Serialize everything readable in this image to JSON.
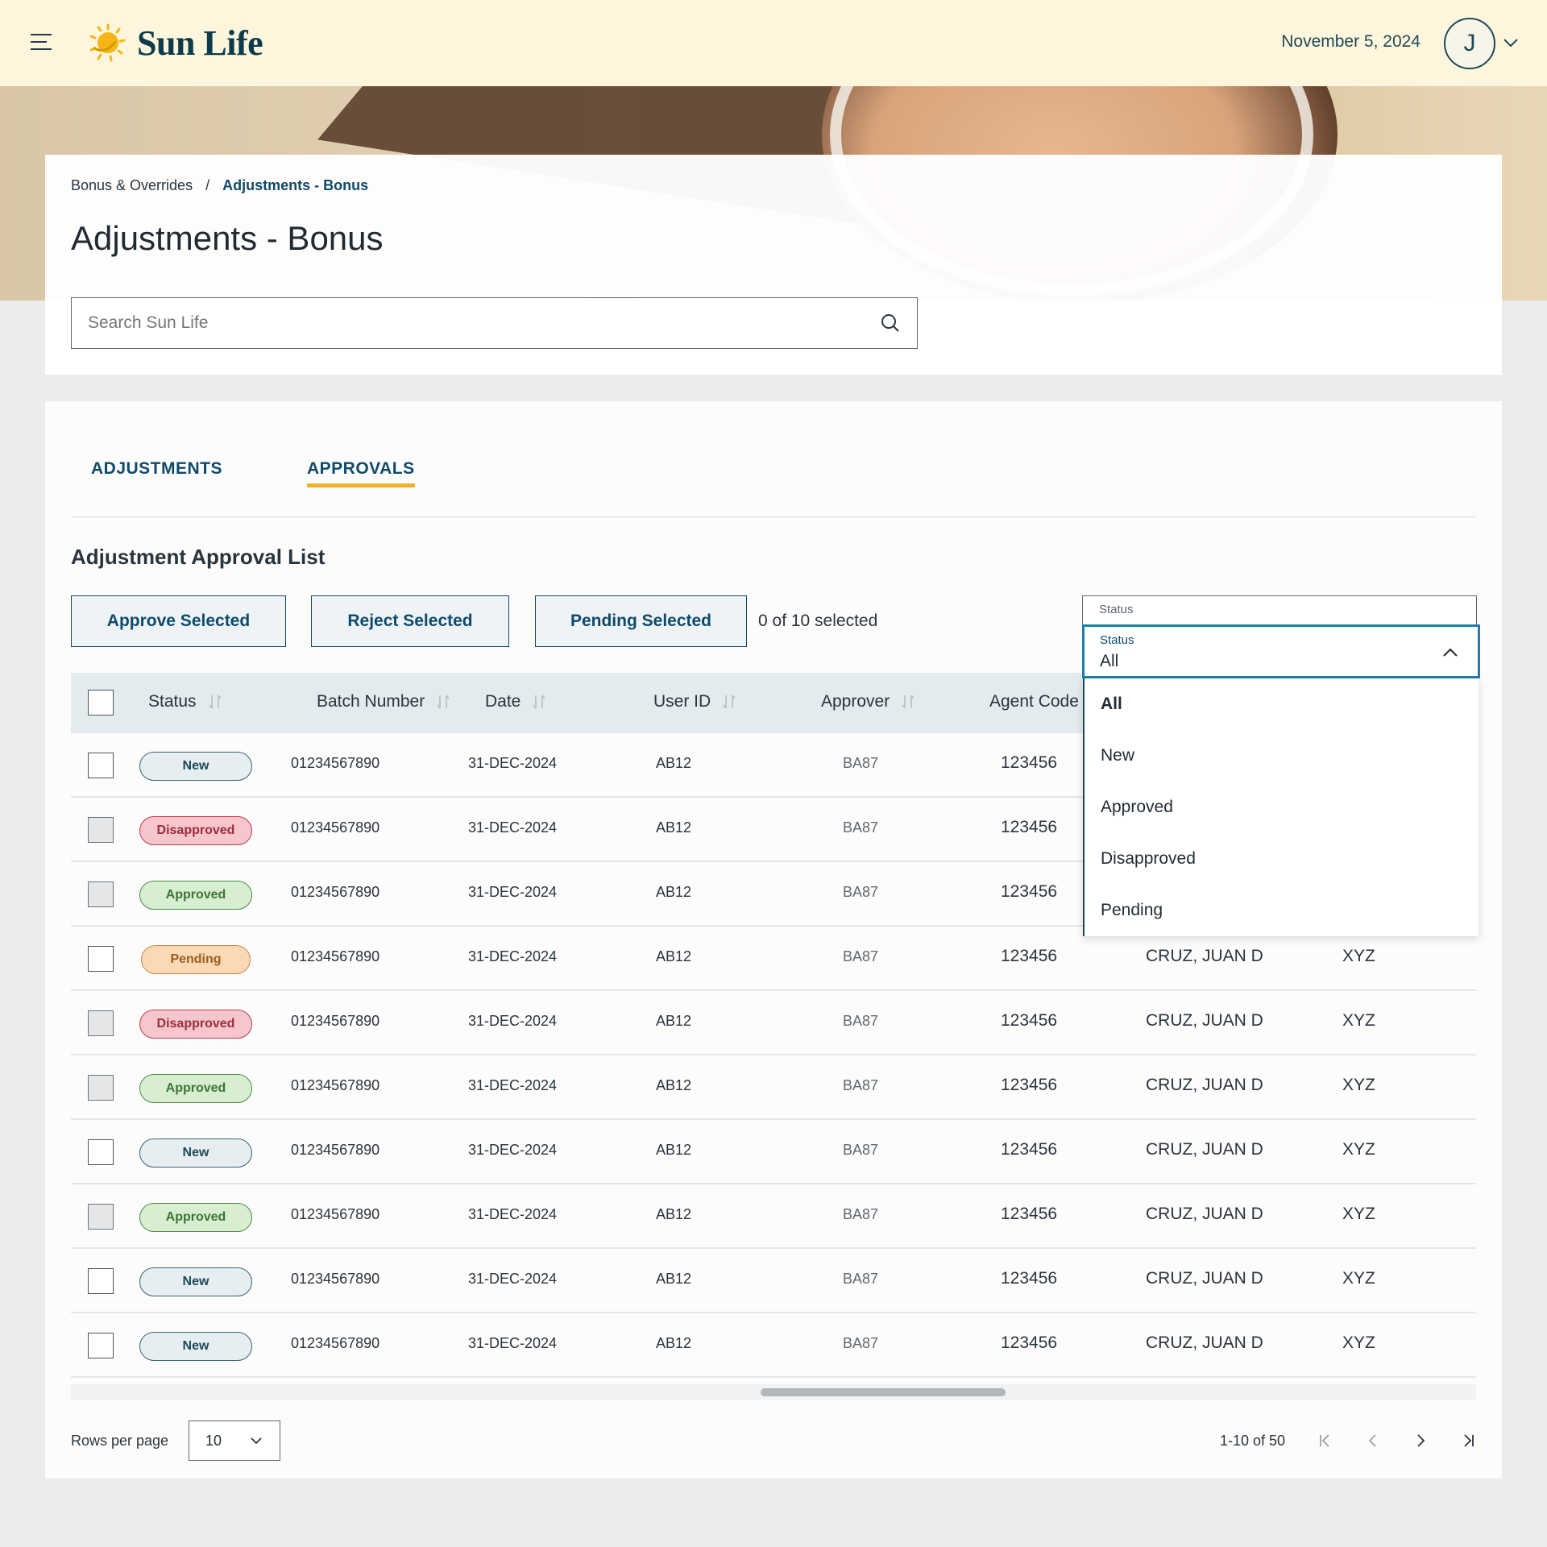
{
  "header": {
    "brand": "Sun Life",
    "date": "November 5, 2024",
    "avatar_initial": "J"
  },
  "breadcrumb": {
    "parent": "Bonus & Overrides",
    "separator": "/",
    "current": "Adjustments - Bonus"
  },
  "page": {
    "title": "Adjustments - Bonus"
  },
  "search": {
    "placeholder": "Search Sun Life"
  },
  "tabs": [
    {
      "label": "ADJUSTMENTS",
      "active": false
    },
    {
      "label": "APPROVALS",
      "active": true
    }
  ],
  "list": {
    "title": "Adjustment Approval List",
    "buttons": {
      "approve": "Approve Selected",
      "reject": "Reject Selected",
      "pending": "Pending Selected"
    },
    "selected_count": "0 of  10 selected"
  },
  "status_filter": {
    "label": "Status",
    "value": "All",
    "options": [
      "All",
      "New",
      "Approved",
      "Disapproved",
      "Pending"
    ],
    "selected": "All"
  },
  "table": {
    "columns": [
      "Status",
      "Batch Number",
      "Date",
      "User ID",
      "Approver",
      "Agent Code"
    ],
    "rows": [
      {
        "status": "New",
        "batch": "01234567890",
        "date": "31-DEC-2024",
        "user_id": "AB12",
        "approver": "BA87",
        "agent_code": "123456",
        "name": "",
        "code": "",
        "checkbox": "empty"
      },
      {
        "status": "Disapproved",
        "batch": "01234567890",
        "date": "31-DEC-2024",
        "user_id": "AB12",
        "approver": "BA87",
        "agent_code": "123456",
        "name": "",
        "code": "",
        "checkbox": "filled"
      },
      {
        "status": "Approved",
        "batch": "01234567890",
        "date": "31-DEC-2024",
        "user_id": "AB12",
        "approver": "BA87",
        "agent_code": "123456",
        "name": "",
        "code": "",
        "checkbox": "filled"
      },
      {
        "status": "Pending",
        "batch": "01234567890",
        "date": "31-DEC-2024",
        "user_id": "AB12",
        "approver": "BA87",
        "agent_code": "123456",
        "name": "CRUZ, JUAN D",
        "code": "XYZ",
        "checkbox": "empty"
      },
      {
        "status": "Disapproved",
        "batch": "01234567890",
        "date": "31-DEC-2024",
        "user_id": "AB12",
        "approver": "BA87",
        "agent_code": "123456",
        "name": "CRUZ, JUAN D",
        "code": "XYZ",
        "checkbox": "filled"
      },
      {
        "status": "Approved",
        "batch": "01234567890",
        "date": "31-DEC-2024",
        "user_id": "AB12",
        "approver": "BA87",
        "agent_code": "123456",
        "name": "CRUZ, JUAN D",
        "code": "XYZ",
        "checkbox": "filled"
      },
      {
        "status": "New",
        "batch": "01234567890",
        "date": "31-DEC-2024",
        "user_id": "AB12",
        "approver": "BA87",
        "agent_code": "123456",
        "name": "CRUZ, JUAN D",
        "code": "XYZ",
        "checkbox": "empty"
      },
      {
        "status": "Approved",
        "batch": "01234567890",
        "date": "31-DEC-2024",
        "user_id": "AB12",
        "approver": "BA87",
        "agent_code": "123456",
        "name": "CRUZ, JUAN D",
        "code": "XYZ",
        "checkbox": "filled"
      },
      {
        "status": "New",
        "batch": "01234567890",
        "date": "31-DEC-2024",
        "user_id": "AB12",
        "approver": "BA87",
        "agent_code": "123456",
        "name": "CRUZ, JUAN D",
        "code": "XYZ",
        "checkbox": "empty"
      },
      {
        "status": "New",
        "batch": "01234567890",
        "date": "31-DEC-2024",
        "user_id": "AB12",
        "approver": "BA87",
        "agent_code": "123456",
        "name": "CRUZ, JUAN D",
        "code": "XYZ",
        "checkbox": "empty"
      }
    ]
  },
  "pagination": {
    "rows_label": "Rows per page",
    "rows_value": "10",
    "range": "1-10 of 50"
  },
  "icons": {
    "menu": "menu-icon",
    "logo": "sun-logo-icon",
    "avatar_chevron": "chevron-down-icon",
    "search": "search-icon",
    "sort": "sort-icon",
    "dropdown_open": "chevron-up-icon",
    "first_page": "first-page-icon",
    "prev_page": "chevron-left-icon",
    "next_page": "chevron-right-icon",
    "last_page": "last-page-icon"
  },
  "colors": {
    "brand_dark": "#0f4a6b",
    "accent_yellow": "#f2b12b",
    "header_bg": "#fdf6dc",
    "focus_blue": "#1e7fa8"
  }
}
